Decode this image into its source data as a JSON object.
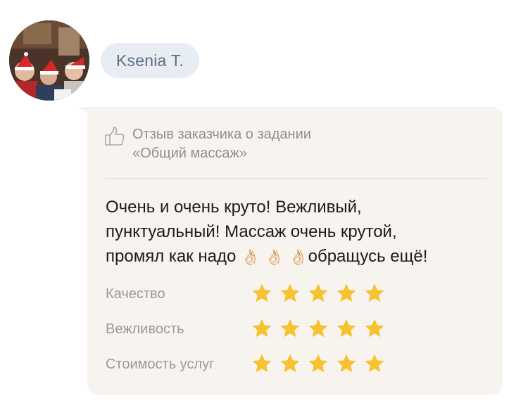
{
  "reviewer": {
    "name": "Ksenia T.",
    "avatar_icon": "avatar-photo"
  },
  "review": {
    "header_icon": "thumbs-up-icon",
    "header_line1": "Отзыв заказчика о задании",
    "header_line2": "«Общий массаж»",
    "text_line1": "Очень и очень круто! Вежливый,",
    "text_line2": "пунктуальный! Массаж очень крутой,",
    "text_line3_start": "промял как надо",
    "text_line3_emoji": "👌🏻",
    "text_line3_end": "обращусь ещё!"
  },
  "ratings": [
    {
      "label": "Качество",
      "stars": 5,
      "max": 5
    },
    {
      "label": "Вежливость",
      "stars": 5,
      "max": 5
    },
    {
      "label": "Стоимость услуг",
      "stars": 5,
      "max": 5
    }
  ],
  "colors": {
    "bubble_bg": "#f7f4ef",
    "name_pill_bg": "#e8edf3",
    "name_text": "#5e6f82",
    "star_fill": "#f6c22f",
    "muted_text": "#8f8f8f"
  }
}
